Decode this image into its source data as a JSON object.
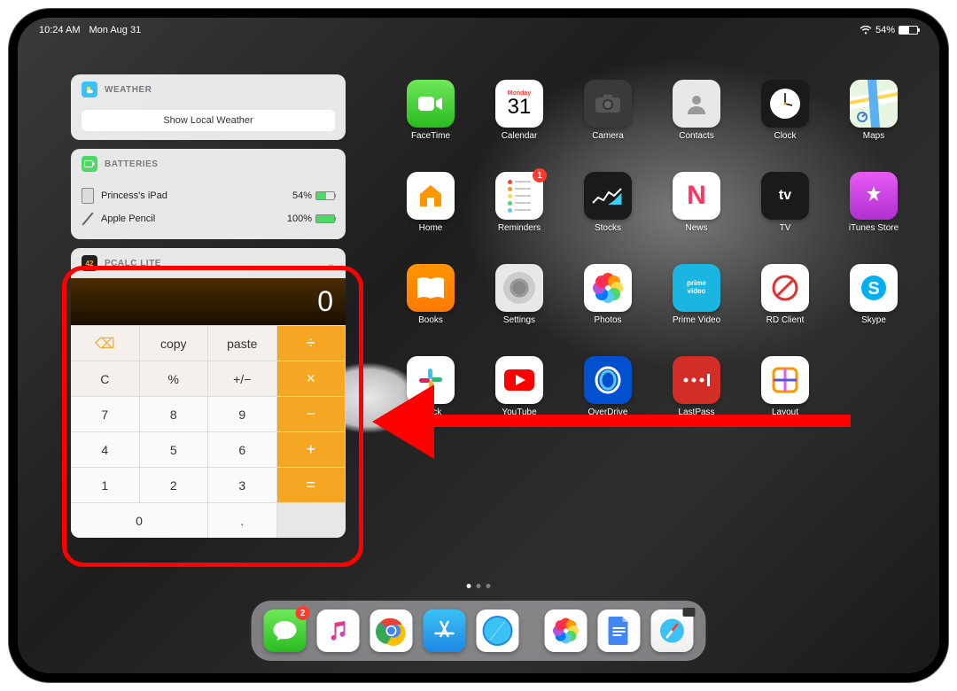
{
  "status": {
    "time": "10:24 AM",
    "date": "Mon Aug 31",
    "battery_pct": "54%"
  },
  "widgets": {
    "weather": {
      "title": "WEATHER",
      "button": "Show Local Weather"
    },
    "batteries": {
      "title": "BATTERIES",
      "items": [
        {
          "name": "Princess's iPad",
          "pct": "54%"
        },
        {
          "name": "Apple Pencil",
          "pct": "100%"
        }
      ]
    },
    "pcalc": {
      "title": "PCALC LITE",
      "icon_label": "42",
      "display": "0",
      "keys": {
        "del": "⌫",
        "copy": "copy",
        "paste": "paste",
        "div": "÷",
        "c": "C",
        "pct": "%",
        "pm": "+/−",
        "mul": "×",
        "k7": "7",
        "k8": "8",
        "k9": "9",
        "sub": "−",
        "k4": "4",
        "k5": "5",
        "k6": "6",
        "add": "+",
        "k1": "1",
        "k2": "2",
        "k3": "3",
        "eq": "=",
        "k0": "0",
        "dot": "."
      }
    }
  },
  "apps": {
    "facetime": "FaceTime",
    "calendar": {
      "label": "Calendar",
      "day": "Monday",
      "num": "31"
    },
    "camera": "Camera",
    "contacts": "Contacts",
    "clock": "Clock",
    "maps": "Maps",
    "home": "Home",
    "reminders": {
      "label": "Reminders",
      "badge": "1"
    },
    "stocks": "Stocks",
    "news": "News",
    "tv": "TV",
    "itunes": "iTunes Store",
    "books": "Books",
    "settings": "Settings",
    "photos": "Photos",
    "prime": "Prime Video",
    "rd": "RD Client",
    "skype": "Skype",
    "slack": "Slack",
    "youtube": "YouTube",
    "overdrive": "OverDrive",
    "lastpass": "LastPass",
    "layout": "Layout"
  },
  "dock": {
    "messages_badge": "2"
  }
}
